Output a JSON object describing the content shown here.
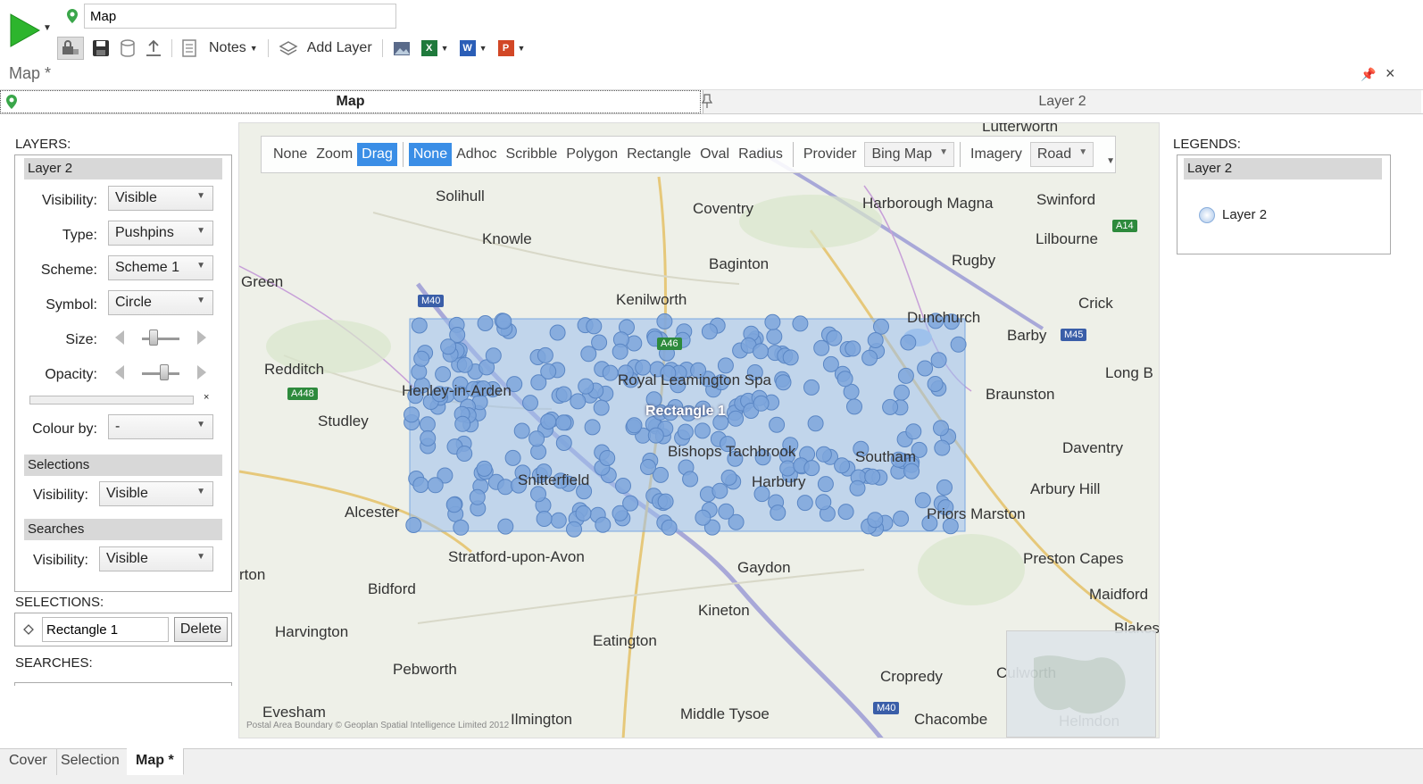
{
  "toolbar": {
    "title_value": "Map",
    "notes_label": "Notes",
    "add_layer_label": "Add Layer"
  },
  "panel": {
    "title": "Map *"
  },
  "tabs": {
    "map": "Map",
    "layer2": "Layer 2"
  },
  "left": {
    "layers_title": "LAYERS:",
    "layer_name": "Layer 2",
    "visibility_label": "Visibility:",
    "visibility_value": "Visible",
    "type_label": "Type:",
    "type_value": "Pushpins",
    "scheme_label": "Scheme:",
    "scheme_value": "Scheme 1",
    "symbol_label": "Symbol:",
    "symbol_value": "Circle",
    "size_label": "Size:",
    "size_level": 0.3,
    "opacity_label": "Opacity:",
    "opacity_level": 0.6,
    "colour_label": "Colour by:",
    "colour_value": "-",
    "selections_head": "Selections",
    "sel_visibility_label": "Visibility:",
    "sel_visibility_value": "Visible",
    "searches_head": "Searches",
    "search_visibility_label": "Visibility:",
    "search_visibility_value": "Visible",
    "selections_title": "SELECTIONS:",
    "selection_name": "Rectangle 1",
    "delete_label": "Delete",
    "searches_title": "SEARCHES:"
  },
  "map": {
    "nav_modes": [
      "None",
      "Zoom",
      "Drag"
    ],
    "nav_active": "Drag",
    "select_modes": [
      "None",
      "Adhoc",
      "Scribble",
      "Polygon",
      "Rectangle",
      "Oval",
      "Radius"
    ],
    "select_active": "None",
    "provider_label": "Provider",
    "provider_value": "Bing Map",
    "imagery_label": "Imagery",
    "imagery_value": "Road",
    "selection_label": "Rectangle 1",
    "copyright": "Postal Area Boundary © Geoplan Spatial Intelligence Limited 2012",
    "towns": [
      "Lutterworth",
      "Solihull",
      "Coventry",
      "Harborough Magna",
      "Swinford",
      "Knowle",
      "Lilbourne",
      "Baginton",
      "Rugby",
      "Green",
      "Kenilworth",
      "Crick",
      "Dunchurch",
      "Barby",
      "Redditch",
      "Long B",
      "Braunston",
      "Studley",
      "Daventry",
      "Arbury Hill",
      "Alcester",
      "Priors Marston",
      "Stratford-upon-Avon",
      "Gaydon",
      "Preston Capes",
      "rton",
      "Bidford",
      "Maidford",
      "Kineton",
      "Blakes",
      "Harvington",
      "Eatington",
      "Pebworth",
      "Cropredy",
      "Culworth",
      "Evesham",
      "Ilmington",
      "Middle Tysoe",
      "Chacombe",
      "Helmdon",
      "Royal Leamington Spa",
      "Bishops Tachbrook",
      "Snitterfield",
      "Henley-in-Arden",
      "Harbury",
      "Southam"
    ],
    "road_labels": [
      "M40",
      "A448",
      "A46",
      "M45",
      "A14",
      "M40"
    ]
  },
  "legend": {
    "title": "LEGENDS:",
    "layer_head": "Layer 2",
    "entry": "Layer 2"
  },
  "sheets": [
    "Cover",
    "Selection",
    "Map *"
  ],
  "colors": {
    "accent": "#3a8ee6",
    "pin": "#7ea6dc",
    "selection": "#9cc0ec"
  }
}
